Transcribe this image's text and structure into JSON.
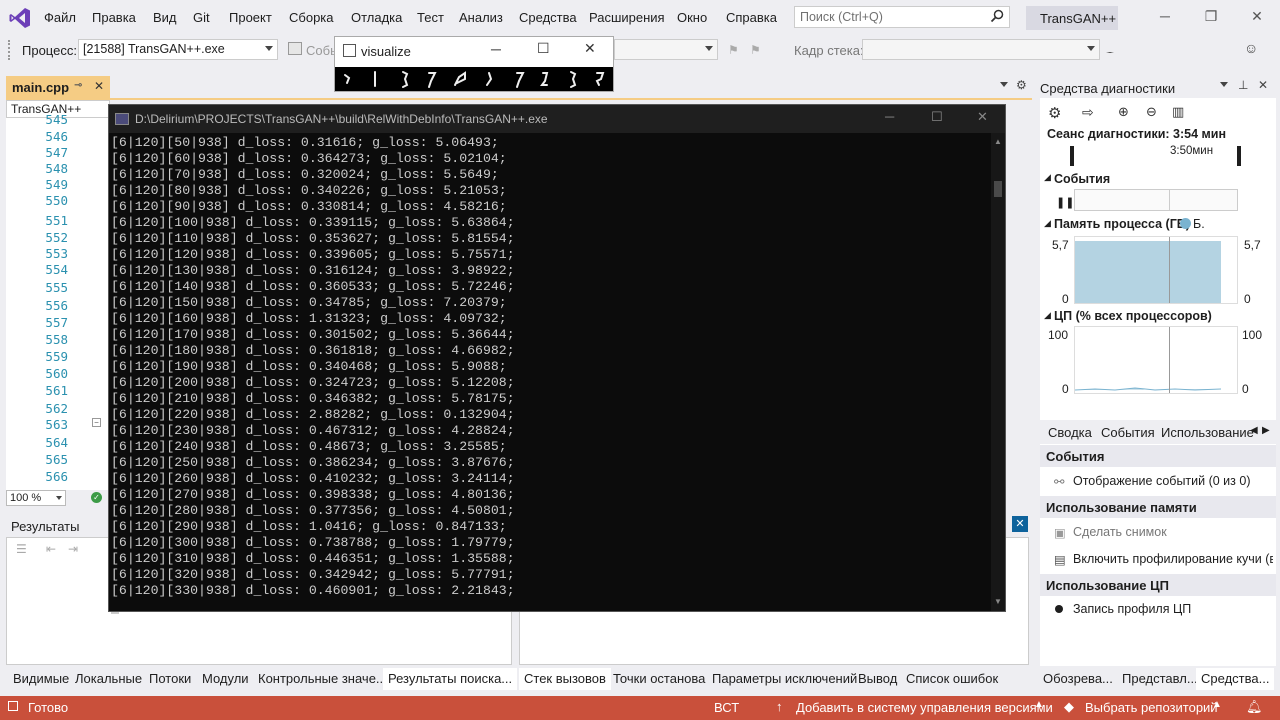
{
  "menubar": {
    "items": [
      "Файл",
      "Правка",
      "Вид",
      "Git",
      "Проект",
      "Сборка",
      "Отладка",
      "Тест",
      "Анализ",
      "Средства",
      "Расширения",
      "Окно",
      "Справка"
    ],
    "search_placeholder": "Поиск (Ctrl+Q)",
    "solution_name": "TransGAN++"
  },
  "toolbar": {
    "process_label": "Процесс:",
    "process_value": "[21588] TransGAN++.exe",
    "events_label": "Собы",
    "stack_frame_label": "Кадр стека:"
  },
  "editor": {
    "tab_title": "main.cpp",
    "nav_project": "TransGAN++",
    "line_numbers": [
      "545",
      "546",
      "547",
      "548",
      "549",
      "550",
      "551",
      "552",
      "553",
      "554",
      "555",
      "556",
      "557",
      "558",
      "559",
      "560",
      "561",
      "562",
      "563",
      "564",
      "565",
      "566",
      "567"
    ],
    "zoom": "100 %"
  },
  "find_panel": {
    "title": "Результаты поиска"
  },
  "bottom_left_tabs": [
    "Видимые",
    "Локальные",
    "Потоки",
    "Модули",
    "Контрольные значе...",
    "Результаты поиска..."
  ],
  "bottom_right_tabs": [
    "Стек вызовов",
    "Точки останова",
    "Параметры исключений",
    "Вывод",
    "Список ошибок"
  ],
  "statusbar": {
    "ready": "Готово",
    "insert_mode": "ВСТ",
    "add_vcs": "Добавить в систему управления версиями",
    "select_repo": "Выбрать репозиторий"
  },
  "visualize_window": {
    "title": "visualize"
  },
  "console": {
    "title": "D:\\Delirium\\PROJECTS\\TransGAN++\\build\\RelWithDebInfo\\TransGAN++.exe",
    "lines": [
      "[6|120][50|938] d_loss: 0.31616; g_loss: 5.06493;",
      "[6|120][60|938] d_loss: 0.364273; g_loss: 5.02104;",
      "[6|120][70|938] d_loss: 0.320024; g_loss: 5.5649;",
      "[6|120][80|938] d_loss: 0.340226; g_loss: 5.21053;",
      "[6|120][90|938] d_loss: 0.330814; g_loss: 4.58216;",
      "[6|120][100|938] d_loss: 0.339115; g_loss: 5.63864;",
      "[6|120][110|938] d_loss: 0.353627; g_loss: 5.81554;",
      "[6|120][120|938] d_loss: 0.339605; g_loss: 5.75571;",
      "[6|120][130|938] d_loss: 0.316124; g_loss: 3.98922;",
      "[6|120][140|938] d_loss: 0.360533; g_loss: 5.72246;",
      "[6|120][150|938] d_loss: 0.34785; g_loss: 7.20379;",
      "[6|120][160|938] d_loss: 1.31323; g_loss: 4.09732;",
      "[6|120][170|938] d_loss: 0.301502; g_loss: 5.36644;",
      "[6|120][180|938] d_loss: 0.361818; g_loss: 4.66982;",
      "[6|120][190|938] d_loss: 0.340468; g_loss: 5.9088;",
      "[6|120][200|938] d_loss: 0.324723; g_loss: 5.12208;",
      "[6|120][210|938] d_loss: 0.346382; g_loss: 5.78175;",
      "[6|120][220|938] d_loss: 2.88282; g_loss: 0.132904;",
      "[6|120][230|938] d_loss: 0.467312; g_loss: 4.28824;",
      "[6|120][240|938] d_loss: 0.48673; g_loss: 3.25585;",
      "[6|120][250|938] d_loss: 0.386234; g_loss: 3.87676;",
      "[6|120][260|938] d_loss: 0.410232; g_loss: 3.24114;",
      "[6|120][270|938] d_loss: 0.398338; g_loss: 4.80136;",
      "[6|120][280|938] d_loss: 0.377356; g_loss: 4.50801;",
      "[6|120][290|938] d_loss: 1.0416; g_loss: 0.847133;",
      "[6|120][300|938] d_loss: 0.738788; g_loss: 1.79779;",
      "[6|120][310|938] d_loss: 0.446351; g_loss: 1.35588;",
      "[6|120][320|938] d_loss: 0.342942; g_loss: 5.77791;",
      "[6|120][330|938] d_loss: 0.460901; g_loss: 2.21843;"
    ]
  },
  "diagnostics": {
    "title": "Средства диагностики",
    "session": "Сеанс диагностики: 3:54 мин",
    "timeline_label": "3:50мин",
    "events_section": "События",
    "memory_section": "Память процесса (ГБ)",
    "memory_legend": "Б.",
    "memory_max": "5,7",
    "memory_min": "0",
    "cpu_section": "ЦП (% всех процессоров)",
    "cpu_max": "100",
    "cpu_min": "0",
    "tabs": [
      "Сводка",
      "События",
      "Использование"
    ],
    "events_head": "События",
    "events_item": "Отображение событий (0 из 0)",
    "memory_head": "Использование памяти",
    "snapshot": "Сделать снимок",
    "heap_profiling": "Включить профилирование кучи (вл",
    "cpu_head": "Использование ЦП",
    "cpu_record": "Запись профиля ЦП",
    "bottom_tabs": [
      "Обозрева...",
      "Представл...",
      "Средства..."
    ]
  },
  "colors": {
    "statusbar": "#c9503b",
    "tab_active": "#f5cc84",
    "memory_fill": "#b4d3e2",
    "console_bg": "#0c0c0c"
  }
}
